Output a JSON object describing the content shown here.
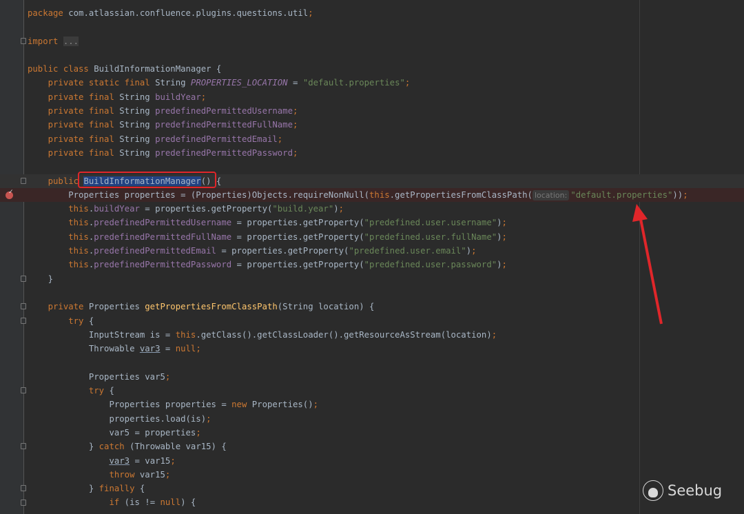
{
  "editor": {
    "lines": [
      {
        "tokens": [
          {
            "t": "package ",
            "c": "k"
          },
          {
            "t": "com.atlassian.confluence.plugins.questions.util",
            "c": "p"
          },
          {
            "t": ";",
            "c": "k"
          }
        ]
      },
      {
        "tokens": []
      },
      {
        "tokens": [
          {
            "t": "import ",
            "c": "k"
          },
          {
            "t": "...",
            "c": "fold"
          }
        ]
      },
      {
        "tokens": []
      },
      {
        "tokens": [
          {
            "t": "public class ",
            "c": "k"
          },
          {
            "t": "BuildInformationManager {",
            "c": "p"
          }
        ]
      },
      {
        "tokens": [
          {
            "t": "    private static final ",
            "c": "k"
          },
          {
            "t": "String ",
            "c": "p"
          },
          {
            "t": "PROPERTIES_LOCATION",
            "c": "fi"
          },
          {
            "t": " = ",
            "c": "p"
          },
          {
            "t": "\"default.properties\"",
            "c": "s"
          },
          {
            "t": ";",
            "c": "k"
          }
        ]
      },
      {
        "tokens": [
          {
            "t": "    private final ",
            "c": "k"
          },
          {
            "t": "String ",
            "c": "p"
          },
          {
            "t": "buildYear",
            "c": "f"
          },
          {
            "t": ";",
            "c": "k"
          }
        ]
      },
      {
        "tokens": [
          {
            "t": "    private final ",
            "c": "k"
          },
          {
            "t": "String ",
            "c": "p"
          },
          {
            "t": "predefinedPermittedUsername",
            "c": "f"
          },
          {
            "t": ";",
            "c": "k"
          }
        ]
      },
      {
        "tokens": [
          {
            "t": "    private final ",
            "c": "k"
          },
          {
            "t": "String ",
            "c": "p"
          },
          {
            "t": "predefinedPermittedFullName",
            "c": "f"
          },
          {
            "t": ";",
            "c": "k"
          }
        ]
      },
      {
        "tokens": [
          {
            "t": "    private final ",
            "c": "k"
          },
          {
            "t": "String ",
            "c": "p"
          },
          {
            "t": "predefinedPermittedEmail",
            "c": "f"
          },
          {
            "t": ";",
            "c": "k"
          }
        ]
      },
      {
        "tokens": [
          {
            "t": "    private final ",
            "c": "k"
          },
          {
            "t": "String ",
            "c": "p"
          },
          {
            "t": "predefinedPermittedPassword",
            "c": "f"
          },
          {
            "t": ";",
            "c": "k"
          }
        ]
      },
      {
        "tokens": []
      },
      {
        "state": "current",
        "tokens": [
          {
            "t": "    public ",
            "c": "k"
          },
          {
            "t": "BuildInformationManager",
            "c": "sel"
          },
          {
            "t": "() {",
            "c": "p"
          }
        ]
      },
      {
        "state": "bp",
        "tokens": [
          {
            "t": "        Properties properties = (Properties)Objects.requireNonNull(",
            "c": "p"
          },
          {
            "t": "this",
            "c": "k"
          },
          {
            "t": ".getPropertiesFromClassPath(",
            "c": "p"
          },
          {
            "t": "location:",
            "c": "h"
          },
          {
            "t": "\"default.properties\"",
            "c": "s"
          },
          {
            "t": "))",
            "c": "p"
          },
          {
            "t": ";",
            "c": "k"
          }
        ]
      },
      {
        "tokens": [
          {
            "t": "        this",
            "c": "k"
          },
          {
            "t": ".",
            "c": "p"
          },
          {
            "t": "buildYear",
            "c": "f"
          },
          {
            "t": " = properties.getProperty(",
            "c": "p"
          },
          {
            "t": "\"build.year\"",
            "c": "s"
          },
          {
            "t": ")",
            "c": "p"
          },
          {
            "t": ";",
            "c": "k"
          }
        ]
      },
      {
        "tokens": [
          {
            "t": "        this",
            "c": "k"
          },
          {
            "t": ".",
            "c": "p"
          },
          {
            "t": "predefinedPermittedUsername",
            "c": "f"
          },
          {
            "t": " = properties.getProperty(",
            "c": "p"
          },
          {
            "t": "\"predefined.user.username\"",
            "c": "s"
          },
          {
            "t": ")",
            "c": "p"
          },
          {
            "t": ";",
            "c": "k"
          }
        ]
      },
      {
        "tokens": [
          {
            "t": "        this",
            "c": "k"
          },
          {
            "t": ".",
            "c": "p"
          },
          {
            "t": "predefinedPermittedFullName",
            "c": "f"
          },
          {
            "t": " = properties.getProperty(",
            "c": "p"
          },
          {
            "t": "\"predefined.user.fullName\"",
            "c": "s"
          },
          {
            "t": ")",
            "c": "p"
          },
          {
            "t": ";",
            "c": "k"
          }
        ]
      },
      {
        "tokens": [
          {
            "t": "        this",
            "c": "k"
          },
          {
            "t": ".",
            "c": "p"
          },
          {
            "t": "predefinedPermittedEmail",
            "c": "f"
          },
          {
            "t": " = properties.getProperty(",
            "c": "p"
          },
          {
            "t": "\"predefined.user.email\"",
            "c": "s"
          },
          {
            "t": ")",
            "c": "p"
          },
          {
            "t": ";",
            "c": "k"
          }
        ]
      },
      {
        "tokens": [
          {
            "t": "        this",
            "c": "k"
          },
          {
            "t": ".",
            "c": "p"
          },
          {
            "t": "predefinedPermittedPassword",
            "c": "f"
          },
          {
            "t": " = properties.getProperty(",
            "c": "p"
          },
          {
            "t": "\"predefined.user.password\"",
            "c": "s"
          },
          {
            "t": ")",
            "c": "p"
          },
          {
            "t": ";",
            "c": "k"
          }
        ]
      },
      {
        "tokens": [
          {
            "t": "    }",
            "c": "p"
          }
        ]
      },
      {
        "tokens": []
      },
      {
        "tokens": [
          {
            "t": "    private ",
            "c": "k"
          },
          {
            "t": "Properties ",
            "c": "p"
          },
          {
            "t": "getPropertiesFromClassPath",
            "c": "m"
          },
          {
            "t": "(String location) {",
            "c": "p"
          }
        ]
      },
      {
        "tokens": [
          {
            "t": "        try ",
            "c": "k"
          },
          {
            "t": "{",
            "c": "p"
          }
        ]
      },
      {
        "tokens": [
          {
            "t": "            InputStream is = ",
            "c": "p"
          },
          {
            "t": "this",
            "c": "k"
          },
          {
            "t": ".getClass().getClassLoader().getResourceAsStream(location)",
            "c": "p"
          },
          {
            "t": ";",
            "c": "k"
          }
        ]
      },
      {
        "tokens": [
          {
            "t": "            Throwable ",
            "c": "p"
          },
          {
            "t": "var3",
            "c": "u"
          },
          {
            "t": " = ",
            "c": "p"
          },
          {
            "t": "null;",
            "c": "k"
          }
        ]
      },
      {
        "tokens": []
      },
      {
        "tokens": [
          {
            "t": "            Properties var5",
            "c": "p"
          },
          {
            "t": ";",
            "c": "k"
          }
        ]
      },
      {
        "tokens": [
          {
            "t": "            try ",
            "c": "k"
          },
          {
            "t": "{",
            "c": "p"
          }
        ]
      },
      {
        "tokens": [
          {
            "t": "                Properties properties = ",
            "c": "p"
          },
          {
            "t": "new ",
            "c": "k"
          },
          {
            "t": "Properties()",
            "c": "p"
          },
          {
            "t": ";",
            "c": "k"
          }
        ]
      },
      {
        "tokens": [
          {
            "t": "                properties.load(is)",
            "c": "p"
          },
          {
            "t": ";",
            "c": "k"
          }
        ]
      },
      {
        "tokens": [
          {
            "t": "                var5 = properties",
            "c": "p"
          },
          {
            "t": ";",
            "c": "k"
          }
        ]
      },
      {
        "tokens": [
          {
            "t": "            } ",
            "c": "p"
          },
          {
            "t": "catch ",
            "c": "k"
          },
          {
            "t": "(Throwable var15) {",
            "c": "p"
          }
        ]
      },
      {
        "tokens": [
          {
            "t": "                ",
            "c": "p"
          },
          {
            "t": "var3",
            "c": "u"
          },
          {
            "t": " = var15",
            "c": "p"
          },
          {
            "t": ";",
            "c": "k"
          }
        ]
      },
      {
        "tokens": [
          {
            "t": "                throw ",
            "c": "k"
          },
          {
            "t": "var15",
            "c": "p"
          },
          {
            "t": ";",
            "c": "k"
          }
        ]
      },
      {
        "tokens": [
          {
            "t": "            } ",
            "c": "p"
          },
          {
            "t": "finally ",
            "c": "k"
          },
          {
            "t": "{",
            "c": "p"
          }
        ]
      },
      {
        "tokens": [
          {
            "t": "                if ",
            "c": "k"
          },
          {
            "t": "(is != ",
            "c": "p"
          },
          {
            "t": "null",
            "c": "k"
          },
          {
            "t": ") {",
            "c": "p"
          }
        ]
      }
    ],
    "fold_lines": [
      2,
      12,
      19,
      21,
      22,
      27,
      31,
      34,
      35
    ]
  },
  "watermark": {
    "text": "Seebug"
  },
  "colors": {
    "annotation": "#e0262a",
    "background": "#2b2b2b"
  }
}
